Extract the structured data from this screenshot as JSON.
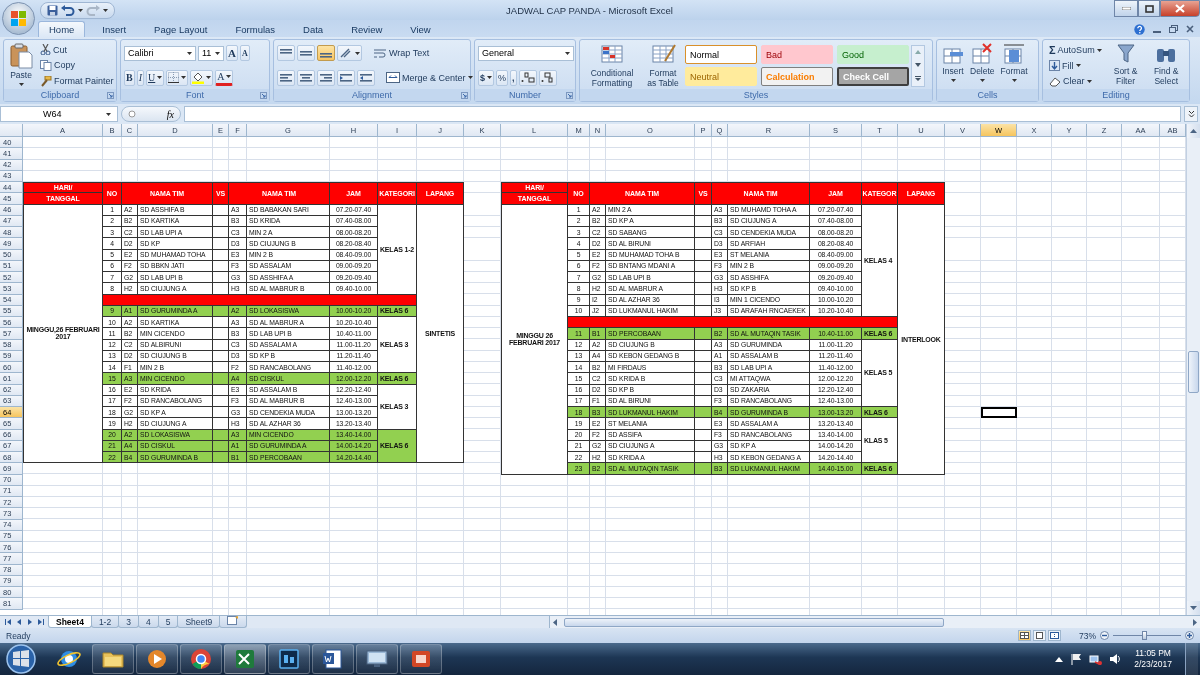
{
  "window": {
    "title": "JADWAL CAP PANDA - Microsoft Excel"
  },
  "ribbon_tabs": [
    {
      "label": "Home",
      "selected": true
    },
    {
      "label": "Insert",
      "selected": false
    },
    {
      "label": "Page Layout",
      "selected": false
    },
    {
      "label": "Formulas",
      "selected": false
    },
    {
      "label": "Data",
      "selected": false
    },
    {
      "label": "Review",
      "selected": false
    },
    {
      "label": "View",
      "selected": false
    }
  ],
  "clipboard": {
    "label": "Clipboard",
    "paste": "Paste",
    "items": [
      "Cut",
      "Copy",
      "Format Painter"
    ]
  },
  "font": {
    "label": "Font",
    "name": "Calibri",
    "size": "11",
    "grow": "A",
    "shrink": "A",
    "styles": [
      "B",
      "I",
      "U"
    ],
    "text_color_label": "A"
  },
  "alignment": {
    "label": "Alignment",
    "wrap": "Wrap Text",
    "merge": "Merge & Center"
  },
  "number": {
    "label": "Number",
    "format": "General",
    "symbols": [
      "$",
      "%",
      ","
    ]
  },
  "styles": {
    "label": "Styles",
    "conditional": "Conditional Formatting",
    "table": "Format as Table",
    "cells": [
      {
        "label": "Normal",
        "kind": "normal"
      },
      {
        "label": "Bad",
        "kind": "bad"
      },
      {
        "label": "Good",
        "kind": "good"
      },
      {
        "label": "Neutral",
        "kind": "neutral"
      },
      {
        "label": "Calculation",
        "kind": "calculation"
      },
      {
        "label": "Check Cell",
        "kind": "check"
      }
    ]
  },
  "cells": {
    "label": "Cells",
    "items": [
      "Insert",
      "Delete",
      "Format"
    ]
  },
  "editing": {
    "label": "Editing",
    "autosum_sign": "Σ",
    "autosum": "AutoSum",
    "fill": "Fill",
    "clear": "Clear",
    "sort": "Sort & Filter",
    "find": "Find & Select"
  },
  "formula_bar": {
    "name_box": "W64",
    "function_label": "fx"
  },
  "sheet": {
    "columns": [
      {
        "label": "A",
        "selected": false
      },
      {
        "label": "B",
        "selected": false
      },
      {
        "label": "C",
        "selected": false
      },
      {
        "label": "D",
        "selected": false
      },
      {
        "label": "E",
        "selected": false
      },
      {
        "label": "F",
        "selected": false
      },
      {
        "label": "G",
        "selected": false
      },
      {
        "label": "H",
        "selected": false
      },
      {
        "label": "I",
        "selected": false
      },
      {
        "label": "J",
        "selected": false
      },
      {
        "label": "K",
        "selected": false
      },
      {
        "label": "L",
        "selected": false
      },
      {
        "label": "M",
        "selected": false
      },
      {
        "label": "N",
        "selected": false
      },
      {
        "label": "O",
        "selected": false
      },
      {
        "label": "P",
        "selected": false
      },
      {
        "label": "Q",
        "selected": false
      },
      {
        "label": "R",
        "selected": false
      },
      {
        "label": "S",
        "selected": false
      },
      {
        "label": "T",
        "selected": false
      },
      {
        "label": "U",
        "selected": false
      },
      {
        "label": "V",
        "selected": false
      },
      {
        "label": "W",
        "selected": true
      },
      {
        "label": "X",
        "selected": false
      },
      {
        "label": "Y",
        "selected": false
      },
      {
        "label": "Z",
        "selected": false
      },
      {
        "label": "AA",
        "selected": false
      },
      {
        "label": "AB",
        "selected": false
      }
    ],
    "rows": [
      {
        "label": "40",
        "selected": false
      },
      {
        "label": "41",
        "selected": false
      },
      {
        "label": "42",
        "selected": false
      },
      {
        "label": "43",
        "selected": false
      },
      {
        "label": "44",
        "selected": false
      },
      {
        "label": "45",
        "selected": false
      },
      {
        "label": "46",
        "selected": false
      },
      {
        "label": "47",
        "selected": false
      },
      {
        "label": "48",
        "selected": false
      },
      {
        "label": "49",
        "selected": false
      },
      {
        "label": "50",
        "selected": false
      },
      {
        "label": "51",
        "selected": false
      },
      {
        "label": "52",
        "selected": false
      },
      {
        "label": "53",
        "selected": false
      },
      {
        "label": "54",
        "selected": false
      },
      {
        "label": "55",
        "selected": false
      },
      {
        "label": "56",
        "selected": false
      },
      {
        "label": "57",
        "selected": false
      },
      {
        "label": "58",
        "selected": false
      },
      {
        "label": "59",
        "selected": false
      },
      {
        "label": "60",
        "selected": false
      },
      {
        "label": "61",
        "selected": false
      },
      {
        "label": "62",
        "selected": false
      },
      {
        "label": "63",
        "selected": false
      },
      {
        "label": "64",
        "selected": true
      },
      {
        "label": "65",
        "selected": false
      },
      {
        "label": "66",
        "selected": false
      },
      {
        "label": "67",
        "selected": false
      },
      {
        "label": "68",
        "selected": false
      },
      {
        "label": "69",
        "selected": false
      },
      {
        "label": "70",
        "selected": false
      },
      {
        "label": "71",
        "selected": false
      },
      {
        "label": "72",
        "selected": false
      },
      {
        "label": "73",
        "selected": false
      },
      {
        "label": "74",
        "selected": false
      },
      {
        "label": "75",
        "selected": false
      },
      {
        "label": "76",
        "selected": false
      },
      {
        "label": "77",
        "selected": false
      },
      {
        "label": "78",
        "selected": false
      },
      {
        "label": "79",
        "selected": false
      },
      {
        "label": "80",
        "selected": false
      },
      {
        "label": "81",
        "selected": false
      }
    ]
  },
  "schedules": [
    {
      "headers": {
        "day": [
          "HARI/",
          "TANGGAL"
        ],
        "no": "NO",
        "team_a": "NAMA TIM",
        "vs": "VS",
        "team_b": "NAMA TIM",
        "time": "JAM",
        "category": "KATEGORI",
        "venue": "LAPANG"
      },
      "date": "MINGGU,26 FEBRUARI 2017",
      "venue": "SINTETIS",
      "sections": [
        {
          "kind": "group",
          "category": "KELAS 1-2",
          "highlighted": false,
          "matches": [
            {
              "no": "1",
              "code_a": "A2",
              "team_a": "SD ASSHIFA B",
              "code_b": "A3",
              "team_b": "SD BABAKAN SARI",
              "time": "07.20-07.40"
            },
            {
              "no": "2",
              "code_a": "B2",
              "team_a": "SD KARTIKA",
              "code_b": "B3",
              "team_b": "SD KRIDA",
              "time": "07.40-08.00"
            },
            {
              "no": "3",
              "code_a": "C2",
              "team_a": "SD LAB UPI A",
              "code_b": "C3",
              "team_b": "MIN 2 A",
              "time": "08.00-08.20"
            },
            {
              "no": "4",
              "code_a": "D2",
              "team_a": "SD KP",
              "code_b": "D3",
              "team_b": "SD CIUJUNG B",
              "time": "08.20-08.40"
            },
            {
              "no": "5",
              "code_a": "E2",
              "team_a": "SD MUHAMAD TOHA",
              "code_b": "E3",
              "team_b": "MIN 2 B",
              "time": "08.40-09.00"
            },
            {
              "no": "6",
              "code_a": "F2",
              "team_a": "SD BBKN JATI",
              "code_b": "F3",
              "team_b": "SD ASSALAM",
              "time": "09.00-09.20"
            },
            {
              "no": "7",
              "code_a": "G2",
              "team_a": "SD LAB UPI B",
              "code_b": "G3",
              "team_b": "SD ASSHIFA A",
              "time": "09.20-09.40"
            },
            {
              "no": "8",
              "code_a": "H2",
              "team_a": "SD CIUJUNG A",
              "code_b": "H3",
              "team_b": "SD AL MABRUR B",
              "time": "09.40-10.00"
            }
          ]
        },
        {
          "kind": "break"
        },
        {
          "kind": "group",
          "category": "KELAS 6",
          "highlighted": true,
          "matches": [
            {
              "no": "9",
              "code_a": "A1",
              "team_a": "SD GURUMINDA A",
              "code_b": "A2",
              "team_b": "SD LOKASISWA",
              "time": "10.00-10.20"
            }
          ]
        },
        {
          "kind": "group",
          "category": "KELAS 3",
          "highlighted": false,
          "matches": [
            {
              "no": "10",
              "code_a": "A2",
              "team_a": "SD KARTIKA",
              "code_b": "A3",
              "team_b": "SD AL MABRUR A",
              "time": "10.20-10.40"
            },
            {
              "no": "11",
              "code_a": "B2",
              "team_a": "MIN CICENDO",
              "code_b": "B3",
              "team_b": "SD LAB UPI B",
              "time": "10.40-11.00"
            },
            {
              "no": "12",
              "code_a": "C2",
              "team_a": "SD ALBIRUNI",
              "code_b": "C3",
              "team_b": "SD ASSALAM A",
              "time": "11.00-11.20"
            },
            {
              "no": "13",
              "code_a": "D2",
              "team_a": "SD CIUJUNG B",
              "code_b": "D3",
              "team_b": "SD KP B",
              "time": "11.20-11.40"
            },
            {
              "no": "14",
              "code_a": "F1",
              "team_a": "MIN 2 B",
              "code_b": "F2",
              "team_b": "SD RANCABOLANG",
              "time": "11.40-12.00"
            }
          ]
        },
        {
          "kind": "group",
          "category": "KELAS 6",
          "highlighted": true,
          "matches": [
            {
              "no": "15",
              "code_a": "A3",
              "team_a": "MIN CICENDO",
              "code_b": "A4",
              "team_b": "SD CISKUL",
              "time": "12.00-12.20"
            }
          ]
        },
        {
          "kind": "group",
          "category": "KELAS 3",
          "highlighted": false,
          "matches": [
            {
              "no": "16",
              "code_a": "E2",
              "team_a": "SD KRIDA",
              "code_b": "E3",
              "team_b": "SD ASSALAM B",
              "time": "12.20-12.40"
            },
            {
              "no": "17",
              "code_a": "F2",
              "team_a": "SD RANCABOLANG",
              "code_b": "F3",
              "team_b": "SD AL MABRUR B",
              "time": "12.40-13.00"
            },
            {
              "no": "18",
              "code_a": "G2",
              "team_a": "SD KP A",
              "code_b": "G3",
              "team_b": "SD CENDEKIA MUDA",
              "time": "13.00-13.20"
            },
            {
              "no": "19",
              "code_a": "H2",
              "team_a": "SD CIUJUNG A",
              "code_b": "H3",
              "team_b": "SD AL AZHAR 36",
              "time": "13.20-13.40"
            }
          ]
        },
        {
          "kind": "group",
          "category": "KELAS 6",
          "highlighted": true,
          "matches": [
            {
              "no": "20",
              "code_a": "A2",
              "team_a": "SD LOKASISWA",
              "code_b": "A3",
              "team_b": "MIN CICENDO",
              "time": "13.40-14.00"
            },
            {
              "no": "21",
              "code_a": "A4",
              "team_a": "SD CISKUL",
              "code_b": "A1",
              "team_b": "SD GURUMINDA A",
              "time": "14.00-14.20"
            },
            {
              "no": "22",
              "code_a": "B4",
              "team_a": "SD GURUMINDA B",
              "code_b": "B1",
              "team_b": "SD PERCOBAAN",
              "time": "14.20-14.40"
            }
          ]
        }
      ]
    },
    {
      "headers": {
        "day": [
          "HARI/",
          "TANGGAL"
        ],
        "no": "NO",
        "team_a": "NAMA TIM",
        "vs": "VS",
        "team_b": "NAMA TIM",
        "time": "JAM",
        "category": "KATEGOR",
        "venue": "LAPANG"
      },
      "date": "MINGGU 26 FEBRUARI 2017",
      "venue": "INTERLOOK",
      "sections": [
        {
          "kind": "group",
          "category": "KELAS 4",
          "highlighted": false,
          "matches": [
            {
              "no": "1",
              "code_a": "A2",
              "team_a": "MIN 2 A",
              "code_b": "A3",
              "team_b": "SD MUHAMD TOHA A",
              "time": "07.20-07.40"
            },
            {
              "no": "2",
              "code_a": "B2",
              "team_a": "SD KP A",
              "code_b": "B3",
              "team_b": "SD CIUJUNG A",
              "time": "07.40-08.00"
            },
            {
              "no": "3",
              "code_a": "C2",
              "team_a": "SD SABANG",
              "code_b": "C3",
              "team_b": "SD CENDEKIA MUDA",
              "time": "08.00-08.20"
            },
            {
              "no": "4",
              "code_a": "D2",
              "team_a": "SD AL BIRUNI",
              "code_b": "D3",
              "team_b": "SD ARFIAH",
              "time": "08.20-08.40"
            },
            {
              "no": "5",
              "code_a": "E2",
              "team_a": "SD MUHAMAD TOHA B",
              "code_b": "E3",
              "team_b": "ST MELANIA",
              "time": "08.40-09.00"
            },
            {
              "no": "6",
              "code_a": "F2",
              "team_a": "SD BNTANG MDANI A",
              "code_b": "F3",
              "team_b": "MIN 2 B",
              "time": "09.00-09.20"
            },
            {
              "no": "7",
              "code_a": "G2",
              "team_a": "SD LAB UPI B",
              "code_b": "G3",
              "team_b": "SD ASSHIFA",
              "time": "09.20-09.40"
            },
            {
              "no": "8",
              "code_a": "H2",
              "team_a": "SD AL MABRUR A",
              "code_b": "H3",
              "team_b": "SD KP B",
              "time": "09.40-10.00"
            },
            {
              "no": "9",
              "code_a": "I2",
              "team_a": "SD AL AZHAR 36",
              "code_b": "I3",
              "team_b": "MIN 1 CICENDO",
              "time": "10.00-10.20"
            },
            {
              "no": "10",
              "code_a": "J2",
              "team_a": "SD LUKMANUL HAKIM",
              "code_b": "J3",
              "team_b": "SD ARAFAH RNCAEKEK",
              "time": "10.20-10.40"
            }
          ]
        },
        {
          "kind": "break"
        },
        {
          "kind": "group",
          "category": "KELAS 6",
          "highlighted": true,
          "matches": [
            {
              "no": "11",
              "code_a": "B1",
              "team_a": "SD PERCOBAAN",
              "code_b": "B2",
              "team_b": "SD AL MUTAQIN TASIK",
              "time": "10.40-11.00"
            }
          ]
        },
        {
          "kind": "group",
          "category": "KELAS 5",
          "highlighted": false,
          "matches": [
            {
              "no": "12",
              "code_a": "A2",
              "team_a": "SD CIUJUNG B",
              "code_b": "A3",
              "team_b": "SD GURUMINDA",
              "time": "11.00-11.20"
            },
            {
              "no": "13",
              "code_a": "A4",
              "team_a": "SD KEBON GEDANG B",
              "code_b": "A1",
              "team_b": "SD ASSALAM B",
              "time": "11.20-11.40"
            },
            {
              "no": "14",
              "code_a": "B2",
              "team_a": "MI FIRDAUS",
              "code_b": "B3",
              "team_b": "SD LAB UPI A",
              "time": "11.40-12.00"
            },
            {
              "no": "15",
              "code_a": "C2",
              "team_a": "SD KRIDA B",
              "code_b": "C3",
              "team_b": "MI ATTAQWA",
              "time": "12.00-12.20"
            },
            {
              "no": "16",
              "code_a": "D2",
              "team_a": "SD KP B",
              "code_b": "D3",
              "team_b": "SD ZAKARIA",
              "time": "12.20-12.40"
            },
            {
              "no": "17",
              "code_a": "F1",
              "team_a": "SD AL BIRUNI",
              "code_b": "F3",
              "team_b": "SD RANCABOLANG",
              "time": "12.40-13.00"
            }
          ]
        },
        {
          "kind": "group",
          "category": "KLAS 6",
          "highlighted": true,
          "matches": [
            {
              "no": "18",
              "code_a": "B3",
              "team_a": "SD LUKMANUL HAKIM",
              "code_b": "B4",
              "team_b": "SD GURUMINDA B",
              "time": "13.00-13.20"
            }
          ]
        },
        {
          "kind": "group",
          "category": "KLAS 5",
          "highlighted": false,
          "matches": [
            {
              "no": "19",
              "code_a": "E2",
              "team_a": "ST MELANIA",
              "code_b": "E3",
              "team_b": "SD ASSALAM A",
              "time": "13.20-13.40"
            },
            {
              "no": "20",
              "code_a": "F2",
              "team_a": "SD ASSIFA",
              "code_b": "F3",
              "team_b": "SD RANCABOLANG",
              "time": "13.40-14.00"
            },
            {
              "no": "21",
              "code_a": "G2",
              "team_a": "SD CIUJUNG A",
              "code_b": "G3",
              "team_b": "SD KP A",
              "time": "14.00-14.20"
            },
            {
              "no": "22",
              "code_a": "H2",
              "team_a": "SD KRIDA A",
              "code_b": "H3",
              "team_b": "SD KEBON GEDANG A",
              "time": "14.20-14.40"
            }
          ]
        },
        {
          "kind": "group",
          "category": "KELAS 6",
          "highlighted": true,
          "matches": [
            {
              "no": "23",
              "code_a": "B2",
              "team_a": "SD AL MUTAQIN TASIK",
              "code_b": "B3",
              "team_b": "SD LUKMANUL HAKIM",
              "time": "14.40-15.00"
            }
          ]
        }
      ]
    }
  ],
  "sheet_tabs": [
    {
      "label": "Sheet4",
      "selected": true
    },
    {
      "label": "1-2",
      "selected": false
    },
    {
      "label": "3",
      "selected": false
    },
    {
      "label": "4",
      "selected": false
    },
    {
      "label": "5",
      "selected": false
    },
    {
      "label": "Sheet9",
      "selected": false
    }
  ],
  "status_bar": {
    "mode": "Ready",
    "zoom": "73%",
    "zoom_slider": {
      "level": 0.45
    }
  },
  "taskbar": {
    "time": "11:05 PM",
    "date": "2/23/2017"
  }
}
